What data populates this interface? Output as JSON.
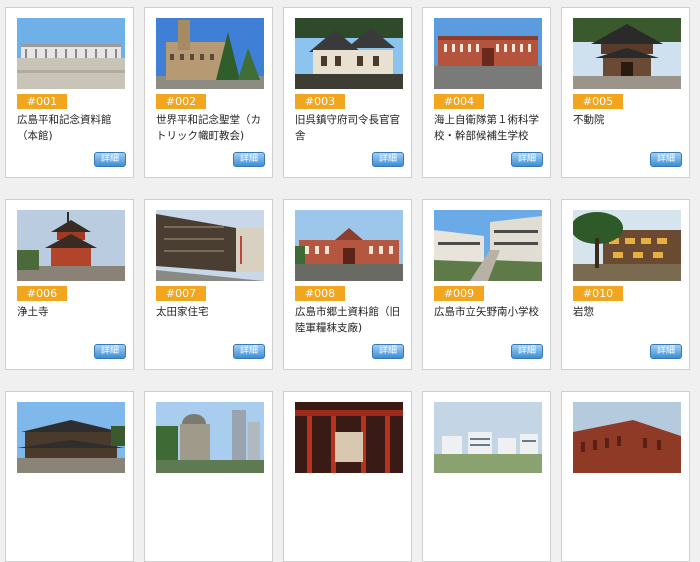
{
  "details_label": "詳細",
  "cards": [
    {
      "number": "#001",
      "title": "広島平和記念資料館（本館)"
    },
    {
      "number": "#002",
      "title": "世界平和記念聖堂（カトリック幟町教会)"
    },
    {
      "number": "#003",
      "title": "旧呉鎮守府司令長官官舎"
    },
    {
      "number": "#004",
      "title": "海上自衛隊第１術科学校・幹部候補生学校"
    },
    {
      "number": "#005",
      "title": "不動院"
    },
    {
      "number": "#006",
      "title": "浄土寺"
    },
    {
      "number": "#007",
      "title": "太田家住宅"
    },
    {
      "number": "#008",
      "title": "広島市郷土資料館（旧陸軍糧秣支廠)"
    },
    {
      "number": "#009",
      "title": "広島市立矢野南小学校"
    },
    {
      "number": "#010",
      "title": "岩惣"
    }
  ],
  "colors": {
    "badge": "#f2a620",
    "button": "#3d8ed6"
  }
}
